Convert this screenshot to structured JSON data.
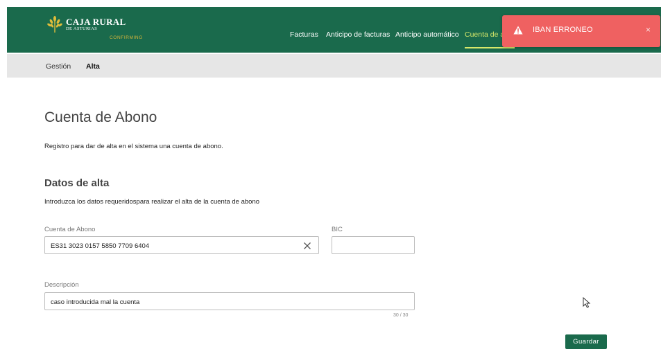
{
  "brand": {
    "title": "CAJA RURAL",
    "subtitle": "DE ASTURIAS",
    "tag": "CONFIRMING",
    "colors": {
      "primary": "#1a6a4c",
      "accent": "#d7e86a",
      "gold": "#d9b63a"
    }
  },
  "nav": {
    "items": [
      {
        "label": "Facturas"
      },
      {
        "label": "Anticipo de facturas"
      },
      {
        "label": "Anticipo automático"
      },
      {
        "label": "Cuenta de ab"
      }
    ]
  },
  "toast": {
    "type": "error",
    "icon": "warning-icon",
    "message": "IBAN ERRONEO",
    "close": "×",
    "color": "#ef6161"
  },
  "subnav": {
    "items": [
      {
        "label": "Gestión"
      },
      {
        "label": "Alta"
      }
    ]
  },
  "page": {
    "title": "Cuenta de Abono",
    "description": "Registro para dar de alta en el sistema una cuenta de abono."
  },
  "section": {
    "title": "Datos de alta",
    "description": "Introduzca los datos requeridospara realizar el alta de la cuenta de abono"
  },
  "form": {
    "account": {
      "label": "Cuenta de Abono",
      "value": "ES31 3023 0157 5850 7709 6404"
    },
    "bic": {
      "label": "BIC",
      "value": ""
    },
    "description": {
      "label": "Descripción",
      "value": "caso introducida mal la cuenta",
      "counter": "30 / 30"
    },
    "save_label": "Guardar"
  }
}
